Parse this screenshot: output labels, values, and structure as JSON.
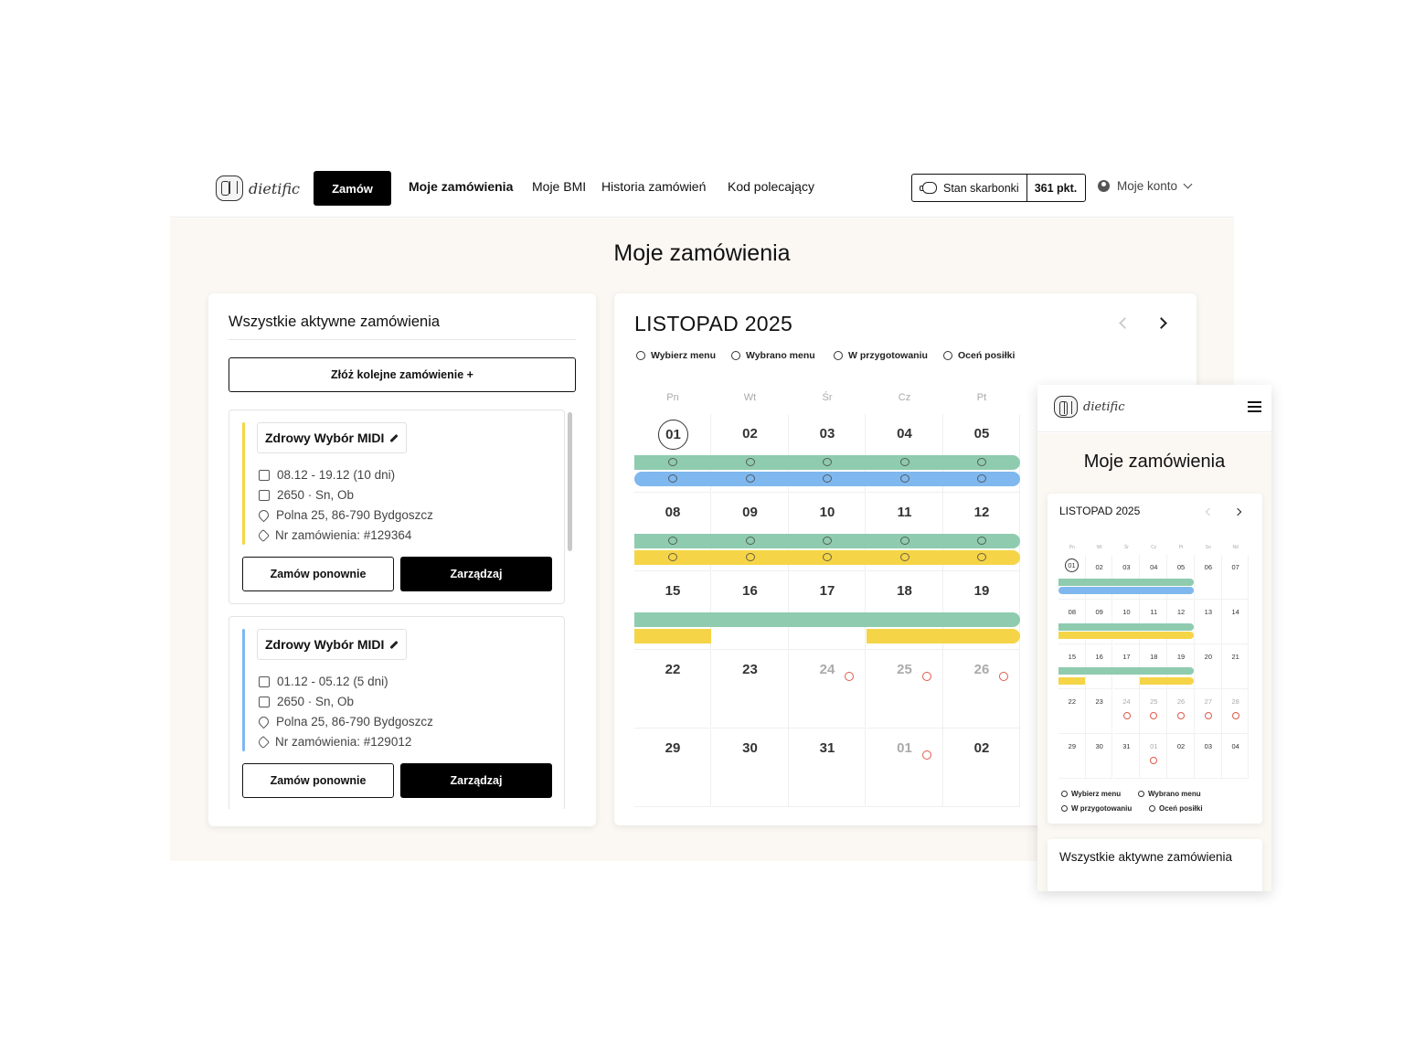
{
  "brand": {
    "logo_text": "dietific"
  },
  "nav": {
    "order_button": "Zamów",
    "items": [
      {
        "label": "Moje zamówienia",
        "active": true
      },
      {
        "label": "Moje BMI",
        "active": false
      },
      {
        "label": "Historia zamówień",
        "active": false
      },
      {
        "label": "Kod polecający",
        "active": false
      }
    ],
    "wallet_label": "Stan skarbonki",
    "wallet_points": "361 pkt.",
    "account_label": "Moje konto"
  },
  "page": {
    "title": "Moje zamówienia"
  },
  "orders": {
    "heading": "Wszystkie aktywne zamówienia",
    "new_order_button": "Złóż kolejne zamówienie  +",
    "reorder_label": "Zamów ponownie",
    "manage_label": "Zarządzaj",
    "list": [
      {
        "name": "Zdrowy Wybór MIDI",
        "dates": "08.12 - 19.12 (10 dni)",
        "plan": "2650 · Sn, Ob",
        "address": "Polna 25, 86-790 Bydgoszcz",
        "number": "Nr zamówienia: #129364",
        "color": "#f5d547"
      },
      {
        "name": "Zdrowy Wybór MIDI",
        "dates": "01.12 - 05.12 (5 dni)",
        "plan": "2650 · Sn, Ob",
        "address": "Polna 25, 86-790 Bydgoszcz",
        "number": "Nr zamówienia: #129012",
        "color": "#7fb8ee"
      }
    ]
  },
  "calendar": {
    "month": "LISTOPAD 2025",
    "legend": [
      "Wybierz menu",
      "Wybrano menu",
      "W przygotowaniu",
      "Oceń posiłki"
    ],
    "weekdays": [
      "Pn",
      "Wt",
      "Śr",
      "Cz",
      "Pt"
    ],
    "weeks": [
      [
        "01",
        "02",
        "03",
        "04",
        "05"
      ],
      [
        "08",
        "09",
        "10",
        "11",
        "12"
      ],
      [
        "15",
        "16",
        "17",
        "18",
        "19"
      ],
      [
        "22",
        "23",
        "24",
        "25",
        "26"
      ],
      [
        "29",
        "30",
        "31",
        "01",
        "02"
      ]
    ],
    "colors": {
      "green": "#8fcbaf",
      "blue": "#7fb8ee",
      "yellow": "#f5d547",
      "alert": "#e05a4a"
    }
  },
  "mobile": {
    "logo_text": "dietific",
    "title": "Moje zamówienia",
    "month": "LISTOPAD 2025",
    "weekdays": [
      "Pn",
      "Wt",
      "Śr",
      "Cz",
      "Pt",
      "So",
      "Nd"
    ],
    "weeks": [
      [
        "01",
        "02",
        "03",
        "04",
        "05",
        "06",
        "07"
      ],
      [
        "08",
        "09",
        "10",
        "11",
        "12",
        "13",
        "14"
      ],
      [
        "15",
        "16",
        "17",
        "18",
        "19",
        "20",
        "21"
      ],
      [
        "22",
        "23",
        "24",
        "25",
        "26",
        "27",
        "28"
      ],
      [
        "29",
        "30",
        "31",
        "01",
        "02",
        "03",
        "04"
      ]
    ],
    "legend": [
      "Wybierz menu",
      "Wybrano menu",
      "W przygotowaniu",
      "Oceń posiłki"
    ],
    "orders_heading": "Wszystkie aktywne zamówienia"
  }
}
